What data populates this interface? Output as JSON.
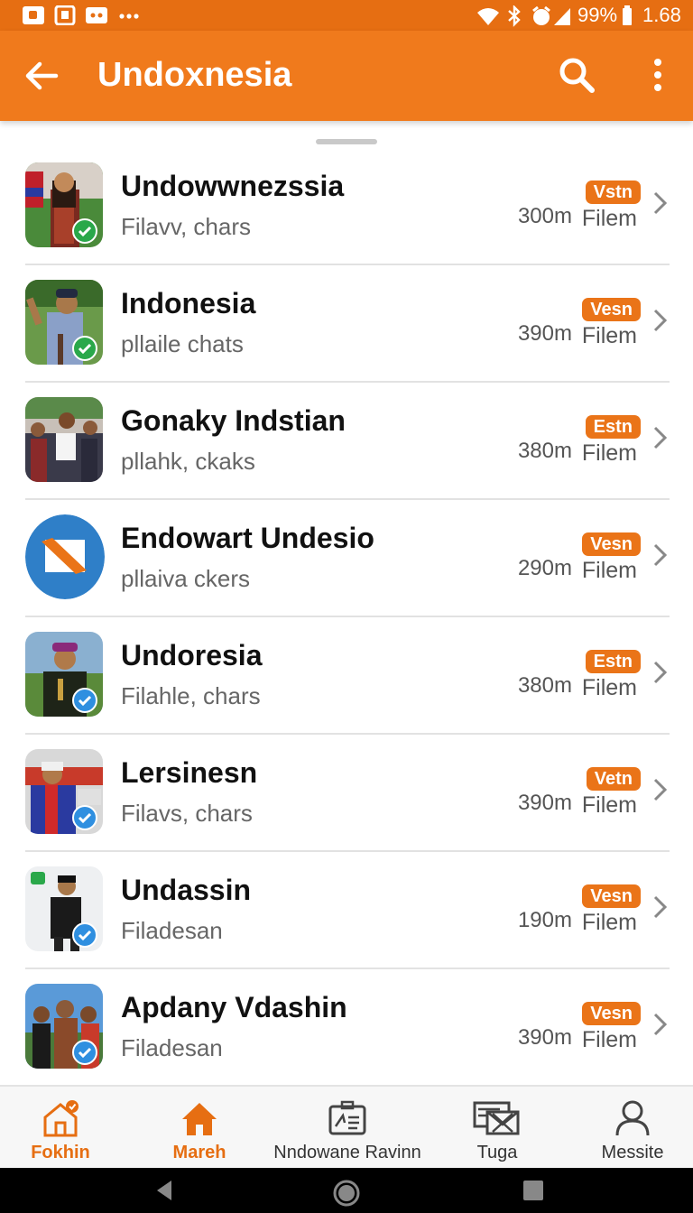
{
  "status_bar": {
    "battery": "99%",
    "time": "1.68"
  },
  "app_bar": {
    "title": "Undoxnesia"
  },
  "list": [
    {
      "name": "Undowwnezssia",
      "sub": "Filavv, chars",
      "tag": "Vstn",
      "distance": "300m",
      "meta": "Filem",
      "verified_color": "#2aa84a"
    },
    {
      "name": "Indonesia",
      "sub": "pllaile chats",
      "tag": "Vesn",
      "distance": "390m",
      "meta": "Filem",
      "verified_color": "#2aa84a"
    },
    {
      "name": "Gonaky Indstian",
      "sub": "pllahk, ckaks",
      "tag": "Estn",
      "distance": "380m",
      "meta": "Filem",
      "verified_color": ""
    },
    {
      "name": "Endowart Undesio",
      "sub": "pllaiva ckers",
      "tag": "Vesn",
      "distance": "290m",
      "meta": "Filem",
      "verified_color": ""
    },
    {
      "name": "Undoresia",
      "sub": "Filahle, chars",
      "tag": "Estn",
      "distance": "380m",
      "meta": "Filem",
      "verified_color": "#2f8fe0"
    },
    {
      "name": "Lersinesn",
      "sub": "Filavs, chars",
      "tag": "Vetn",
      "distance": "390m",
      "meta": "Filem",
      "verified_color": "#2f8fe0"
    },
    {
      "name": "Undassin",
      "sub": "Filadesan",
      "tag": "Vesn",
      "distance": "190m",
      "meta": "Filem",
      "verified_color": "#2f8fe0"
    },
    {
      "name": "Apdany Vdashin",
      "sub": "Filadesan",
      "tag": "Vesn",
      "distance": "390m",
      "meta": "Filem",
      "verified_color": "#2f8fe0"
    }
  ],
  "bottom_nav": [
    {
      "label": "Fokhin",
      "icon": "home-badge-icon",
      "active": true
    },
    {
      "label": "Mareh",
      "icon": "home-icon",
      "active": true
    },
    {
      "label": "Nndowane Ravinn",
      "icon": "id-card-icon",
      "active": false
    },
    {
      "label": "Tuga",
      "icon": "mail-icon",
      "active": false
    },
    {
      "label": "Messite",
      "icon": "profile-icon",
      "active": false
    }
  ],
  "colors": {
    "accent": "#f07a1c",
    "status_bar": "#e66e12",
    "tag": "#ea7418"
  }
}
